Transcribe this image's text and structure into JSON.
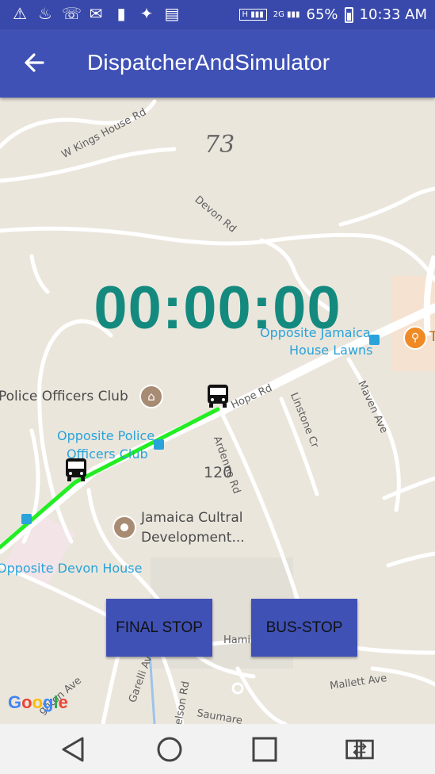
{
  "status_bar": {
    "battery": "65%",
    "time": "10:33 AM",
    "network_2g": "2G",
    "network_h": "H"
  },
  "app_bar": {
    "title": "DispatcherAndSimulator",
    "back_icon": "arrow-left-icon"
  },
  "timer": {
    "value": "00:00:00"
  },
  "map": {
    "road_labels": [
      "W Kings House Rd",
      "Devon Rd",
      "Hope Rd",
      "Ardenne Rd",
      "Linstone Cr",
      "Maven Ave",
      "Mallett Ave",
      "Hamil",
      "Garelli Av",
      "elson Rd",
      "Saumare",
      "ghton Ave"
    ],
    "numbers": [
      "73",
      "120"
    ],
    "pois": [
      "Police Officers Club",
      "Jamaica Cultral",
      "Development..."
    ],
    "transit_stops": [
      "Opposite Jamaica",
      "House Lawns",
      "Opposite Police",
      "Officers Club",
      "Opposite Devon House"
    ],
    "restaurant_letter": "T",
    "attribution": "Google",
    "colors": {
      "route": "#22ee22",
      "road": "#ffffff",
      "land": "#ebe6dc",
      "transit": "#29a3d9"
    }
  },
  "buttons": {
    "final_stop": "FINAL STOP",
    "bus_stop": "BUS-STOP"
  },
  "nav": {
    "back": "triangle-back-icon",
    "home": "circle-home-icon",
    "recents": "square-recents-icon",
    "switch": "dual-window-icon"
  }
}
